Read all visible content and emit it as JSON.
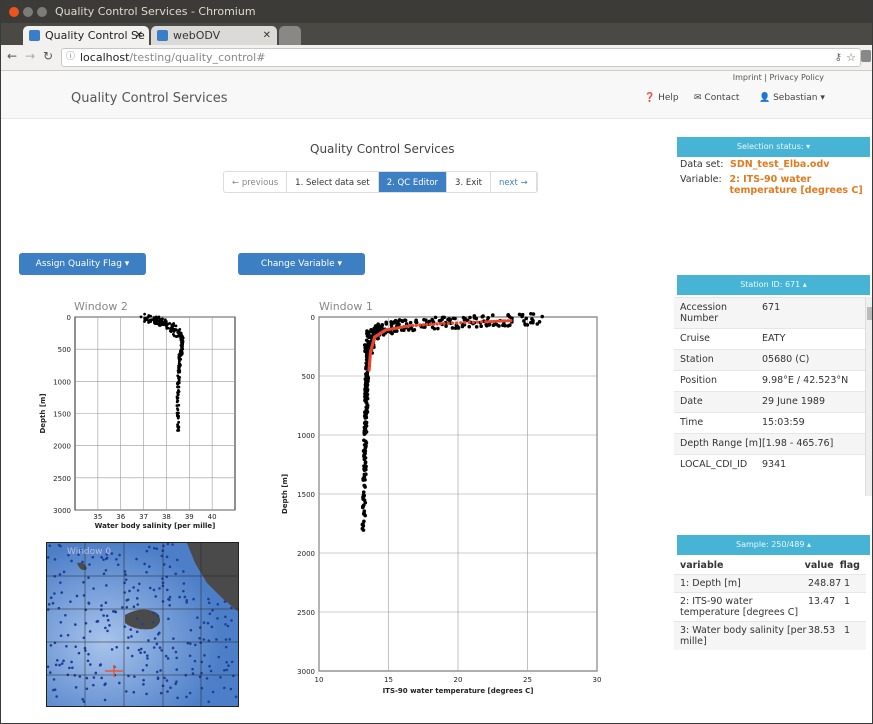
{
  "browser": {
    "window_title": "Quality Control Services - Chromium",
    "tabs": [
      {
        "label": "Quality Control Se",
        "active": true
      },
      {
        "label": "webODV",
        "active": false
      }
    ],
    "url_host": "localhost",
    "url_path": "/testing/quality_control#"
  },
  "header": {
    "brand": "Quality Control Services",
    "top_links": "Imprint | Privacy Policy",
    "help": "Help",
    "contact": "Contact",
    "user": "Sebastian"
  },
  "main": {
    "title": "Quality Control Services",
    "steps": [
      {
        "label": "← previous",
        "state": "prev"
      },
      {
        "label": "1. Select data set",
        "state": "normal"
      },
      {
        "label": "2. QC Editor",
        "state": "selected"
      },
      {
        "label": "3. Exit",
        "state": "normal"
      },
      {
        "label": "next →",
        "state": "next"
      }
    ],
    "assign_flag_label": "Assign Quality Flag",
    "change_variable_label": "Change Variable"
  },
  "windows": {
    "window1_label": "Window 1",
    "window2_label": "Window 2",
    "window0_label": "Window 0"
  },
  "selection_status": {
    "header": "Selection status:",
    "dataset_key": "Data set:",
    "dataset_value": "SDN_test_Elba.odv",
    "variable_key": "Variable:",
    "variable_value": "2: ITS-90 water temperature [degrees C]"
  },
  "station": {
    "header": "Station ID: 671",
    "rows": [
      {
        "k": "Accession Number",
        "v": "671"
      },
      {
        "k": "Cruise",
        "v": "EATY"
      },
      {
        "k": "Station",
        "v": "05680 (C)"
      },
      {
        "k": "Position",
        "v": "9.98°E / 42.523°N"
      },
      {
        "k": "Date",
        "v": "29 June 1989"
      },
      {
        "k": "Time",
        "v": "15:03:59"
      },
      {
        "k": "Depth Range [m]",
        "v": "[1.98 - 465.76]"
      },
      {
        "k": "LOCAL_CDI_ID",
        "v": "9341"
      }
    ]
  },
  "sample": {
    "header": "Sample: 250/489",
    "columns": [
      "variable",
      "value",
      "flag"
    ],
    "rows": [
      {
        "variable": "1: Depth [m]",
        "value": "248.87",
        "flag": "1"
      },
      {
        "variable": "2: ITS-90 water temperature [degrees C]",
        "value": "13.47",
        "flag": "1"
      },
      {
        "variable": "3: Water body salinity [per mille]",
        "value": "38.53",
        "flag": "1"
      }
    ]
  },
  "chart_data": [
    {
      "type": "scatter",
      "name": "Window 1",
      "xlabel": "ITS-90 water temperature [degrees C]",
      "ylabel": "Depth [m]",
      "xlim": [
        10,
        30
      ],
      "ylim": [
        3000,
        0
      ],
      "xticks": [
        10,
        15,
        20,
        25,
        30
      ],
      "yticks": [
        0,
        500,
        1000,
        1500,
        2000,
        2500,
        3000
      ],
      "profile": {
        "x": [
          13.2,
          13.3,
          13.4,
          13.4,
          13.5,
          13.6,
          13.8,
          14.5,
          16,
          19,
          22,
          26
        ],
        "y": [
          1800,
          1200,
          800,
          600,
          400,
          250,
          150,
          100,
          70,
          50,
          35,
          20
        ]
      },
      "highlight": {
        "x": [
          13.6,
          13.7,
          14.0,
          14.8,
          16.5,
          19,
          22,
          24
        ],
        "y": [
          450,
          300,
          170,
          110,
          75,
          55,
          40,
          30
        ]
      }
    },
    {
      "type": "scatter",
      "name": "Window 2",
      "xlabel": "Water body salinity [per mille]",
      "ylabel": "Depth [m]",
      "xlim": [
        34,
        41
      ],
      "ylim": [
        3000,
        0
      ],
      "xticks": [
        35,
        36,
        37,
        38,
        39,
        40
      ],
      "yticks": [
        0,
        500,
        1000,
        1500,
        2000,
        2500,
        3000
      ],
      "profile": {
        "x": [
          38.5,
          38.5,
          38.55,
          38.6,
          38.7,
          38.7,
          38.5,
          38.2,
          37.8,
          37.5,
          37.0
        ],
        "y": [
          1800,
          1200,
          800,
          600,
          450,
          350,
          250,
          150,
          80,
          40,
          10
        ]
      }
    }
  ]
}
